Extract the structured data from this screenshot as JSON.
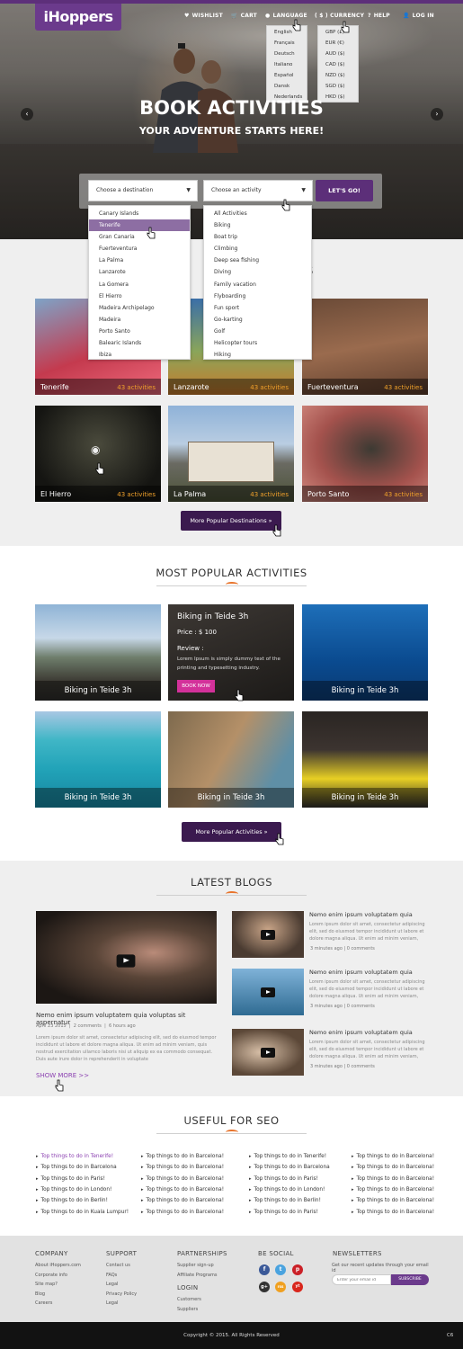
{
  "brand": {
    "logo": "iHoppers",
    "accent": "#5c2f79",
    "orange": "#e8742c"
  },
  "nav": {
    "wishlist": "WISHLIST",
    "cart": "CART",
    "language": "LANGUAGE",
    "currency": "( $ ) CURRENCY",
    "help": "HELP",
    "login": "LOG IN"
  },
  "language_menu": [
    "English",
    "Français",
    "Deutsch",
    "Italiano",
    "Español",
    "Dansk",
    "Nederlands"
  ],
  "currency_menu": [
    "GBP (£)",
    "EUR (€)",
    "AUD ($)",
    "CAD ($)",
    "NZD ($)",
    "SGD ($)",
    "HKD ($)"
  ],
  "hero": {
    "title": "BOOK ACTIVITIES",
    "subtitle": "YOUR ADVENTURE STARTS HERE!",
    "prev": "‹",
    "next": "›"
  },
  "search": {
    "destination_placeholder": "Choose a destination",
    "activity_placeholder": "Choose an activity",
    "button": "LET'S GO!"
  },
  "destination_list": [
    "Canary Islands",
    "Tenerife",
    "Gran Canaria",
    "Fuerteventura",
    "La Palma",
    "Lanzarote",
    "La Gomera",
    "El Hierro",
    "Madeira Archipelago",
    "Madeira",
    "Porto Santo",
    "Balearic Islands",
    "Ibiza"
  ],
  "activity_list": [
    "All Activities",
    "Biking",
    "Boat trip",
    "Climbing",
    "Deep sea fishing",
    "Diving",
    "Family vacation",
    "Flyboarding",
    "Fun sport",
    "Go-karting",
    "Golf",
    "Helicopter tours",
    "Hiking"
  ],
  "destinations": {
    "title_partial": "S",
    "items": [
      {
        "name": "Tenerife",
        "count": "43 activities"
      },
      {
        "name": "Lanzarote",
        "count": "43 activities"
      },
      {
        "name": "Fuerteventura",
        "count": "43 activities"
      },
      {
        "name": "El Hierro",
        "count": "43 activities"
      },
      {
        "name": "La Palma",
        "count": "43 activities"
      },
      {
        "name": "Porto Santo",
        "count": "43 activities"
      }
    ],
    "more": "More Popular Destinations »"
  },
  "activities": {
    "title": "MOST POPULAR ACTIVITIES",
    "items": [
      "Biking in Teide 3h",
      "Biking in Teide 3h",
      "Biking in Teide 3h",
      "Biking in Teide 3h",
      "Biking in Teide 3h",
      "Biking in Teide 3h"
    ],
    "hover": {
      "title": "Biking in Teide 3h",
      "price": "Price : $ 100",
      "review": "Review :",
      "text": "Lorem Ipsum is simply dummy text of the printing and typesetting industry.",
      "book": "BOOK NOW"
    },
    "more": "More Popular Activities »"
  },
  "blogs": {
    "title": "LATEST BLOGS",
    "main": {
      "title": "Nemo enim ipsum voluptatem quia voluptas sit aspernatur",
      "date": "April 23 2015",
      "comments": "2 comments",
      "ago": "6 hours ago",
      "text": "Lorem ipsum dolor sit amet, consectetur adipiscing elit, sed do eiusmod tempor incididunt ut labore et dolore magna aliqua. Ut enim ad minim veniam, quis nostrud exercitation ullamco laboris nisi ut aliquip ex ea commodo consequat. Duis aute irure dolor in reprehenderit in voluptate",
      "more": "SHOW MORE >>"
    },
    "side": [
      {
        "title": "Nemo enim ipsum voluptatem quia",
        "text": "Lorem ipsum dolor sit amet, consectetur adipiscing elit, sed do eiusmod tempor incididunt ut labore et dolore magna aliqua. Ut enim ad minim veniam,",
        "ago": "3 minutes ago",
        "comments": "0 comments"
      },
      {
        "title": "Nemo enim ipsum voluptatem quia",
        "text": "Lorem ipsum dolor sit amet, consectetur adipiscing elit, sed do eiusmod tempor incididunt ut labore et dolore magna aliqua. Ut enim ad minim veniam,",
        "ago": "3 minutes ago",
        "comments": "0 comments"
      },
      {
        "title": "Nemo enim ipsum voluptatem quia",
        "text": "Lorem ipsum dolor sit amet, consectetur adipiscing elit, sed do eiusmod tempor incididunt ut labore et dolore magna aliqua. Ut enim ad minim veniam,",
        "ago": "3 minutes ago",
        "comments": "0 comments"
      }
    ]
  },
  "seo": {
    "title": "USEFUL FOR SEO",
    "columns": [
      [
        "Top things to do in Tenerife!",
        "Top things to do in Barcelona",
        "Top things to do in Paris!",
        "Top things to do in London!",
        "Top things to do in Berlin!",
        "Top things to do in Kuala Lumpur!"
      ],
      [
        "Top things to do in Barcelona!",
        "Top things to do in Barcelona!",
        "Top things to do in Barcelona!",
        "Top things to do in Barcelona!",
        "Top things to do in Barcelona!",
        "Top things to do in Barcelona!"
      ],
      [
        "Top things to do in Tenerife!",
        "Top things to do in Barcelona",
        "Top things to do in Paris!",
        "Top things to do in London!",
        "Top things to do in Berlin!",
        "Top things to do in Paris!"
      ],
      [
        "Top things to do in Barcelona!",
        "Top things to do in Barcelona!",
        "Top things to do in Barcelona!",
        "Top things to do in Barcelona!",
        "Top things to do in Barcelona!",
        "Top things to do in Barcelona!"
      ]
    ]
  },
  "footer": {
    "company": {
      "title": "COMPANY",
      "links": [
        "About iHoppers.com",
        "Corporate info",
        "Site map?",
        "Blog",
        "Careers"
      ]
    },
    "support": {
      "title": "SUPPORT",
      "links": [
        "Contact us",
        "FAQs",
        "Legal",
        "Privacy Policy",
        "Legal"
      ]
    },
    "partnerships": {
      "title": "PARTNERSHIPS",
      "links": [
        "Supplier sign-up",
        "Affiliate Programs"
      ]
    },
    "login": {
      "title": "LOGIN",
      "links": [
        "Customers",
        "Suppliers"
      ]
    },
    "social": {
      "title": "BE SOCIAL",
      "icons": [
        "f",
        "t",
        "p",
        "g+",
        "rss",
        "yt"
      ]
    },
    "newsletter": {
      "title": "NEWSLETTERS",
      "text": "Get our recent updates through your email id",
      "placeholder": "Enter your email id",
      "button": "SUBSCRIBE"
    },
    "copyright": "Copyright © 2015. All Rights Reserved",
    "corner": "C6"
  }
}
